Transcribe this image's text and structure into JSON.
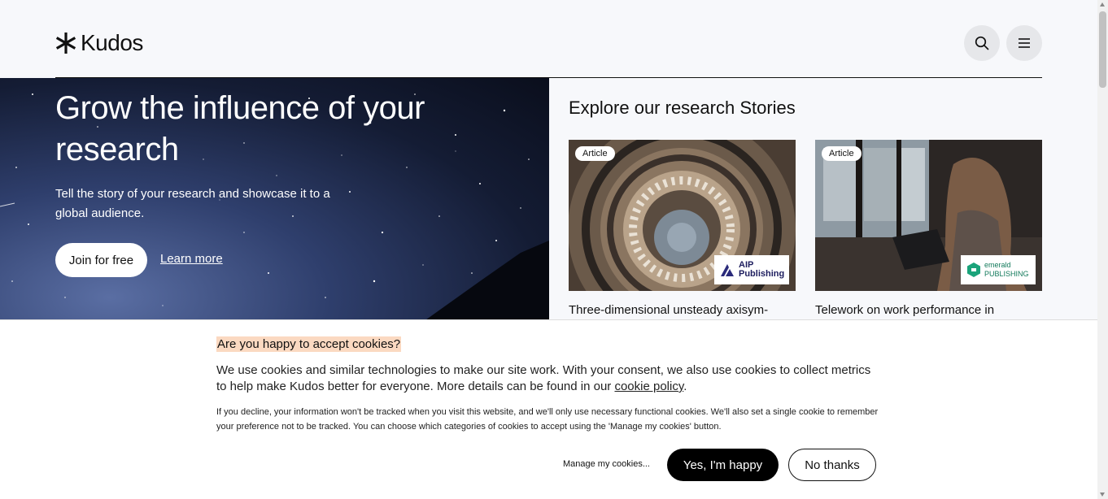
{
  "header": {
    "logo_text": "Kudos",
    "search_icon": "search-icon",
    "menu_icon": "hamburger-menu-icon"
  },
  "hero": {
    "title": "Grow the influence of your research",
    "subtitle": "Tell the story of your research and showcase it to a global audience.",
    "join_label": "Join for free",
    "learn_label": "Learn more"
  },
  "stories": {
    "heading": "Explore our research Stories",
    "cards": [
      {
        "badge": "Article",
        "publisher": "AIP Publishing",
        "title": "Three-dimensional unsteady axisym-"
      },
      {
        "badge": "Article",
        "publisher": "emerald PUBLISHING",
        "title": "Telework on work performance in"
      }
    ]
  },
  "cookie": {
    "title": "Are you happy to accept cookies?",
    "text_before_link": "We use cookies and similar technologies to make our site work. With your consent, we also use cookies to collect metrics to help make Kudos better for everyone. More details can be found in our ",
    "link_label": "cookie policy",
    "text_after_link": ".",
    "small_text": "If you decline, your information won't be tracked when you visit this website, and we'll only use necessary functional cookies. We'll also set a single cookie to remember your preference not to be tracked. You can choose which categories of cookies to accept using the 'Manage my cookies' button.",
    "manage_label": "Manage my cookies...",
    "yes_label": "Yes, I'm happy",
    "no_label": "No thanks"
  },
  "colors": {
    "page_bg": "#f7f8fb",
    "cookie_title_highlight": "#fbd9c1",
    "primary_button": "#000000"
  }
}
